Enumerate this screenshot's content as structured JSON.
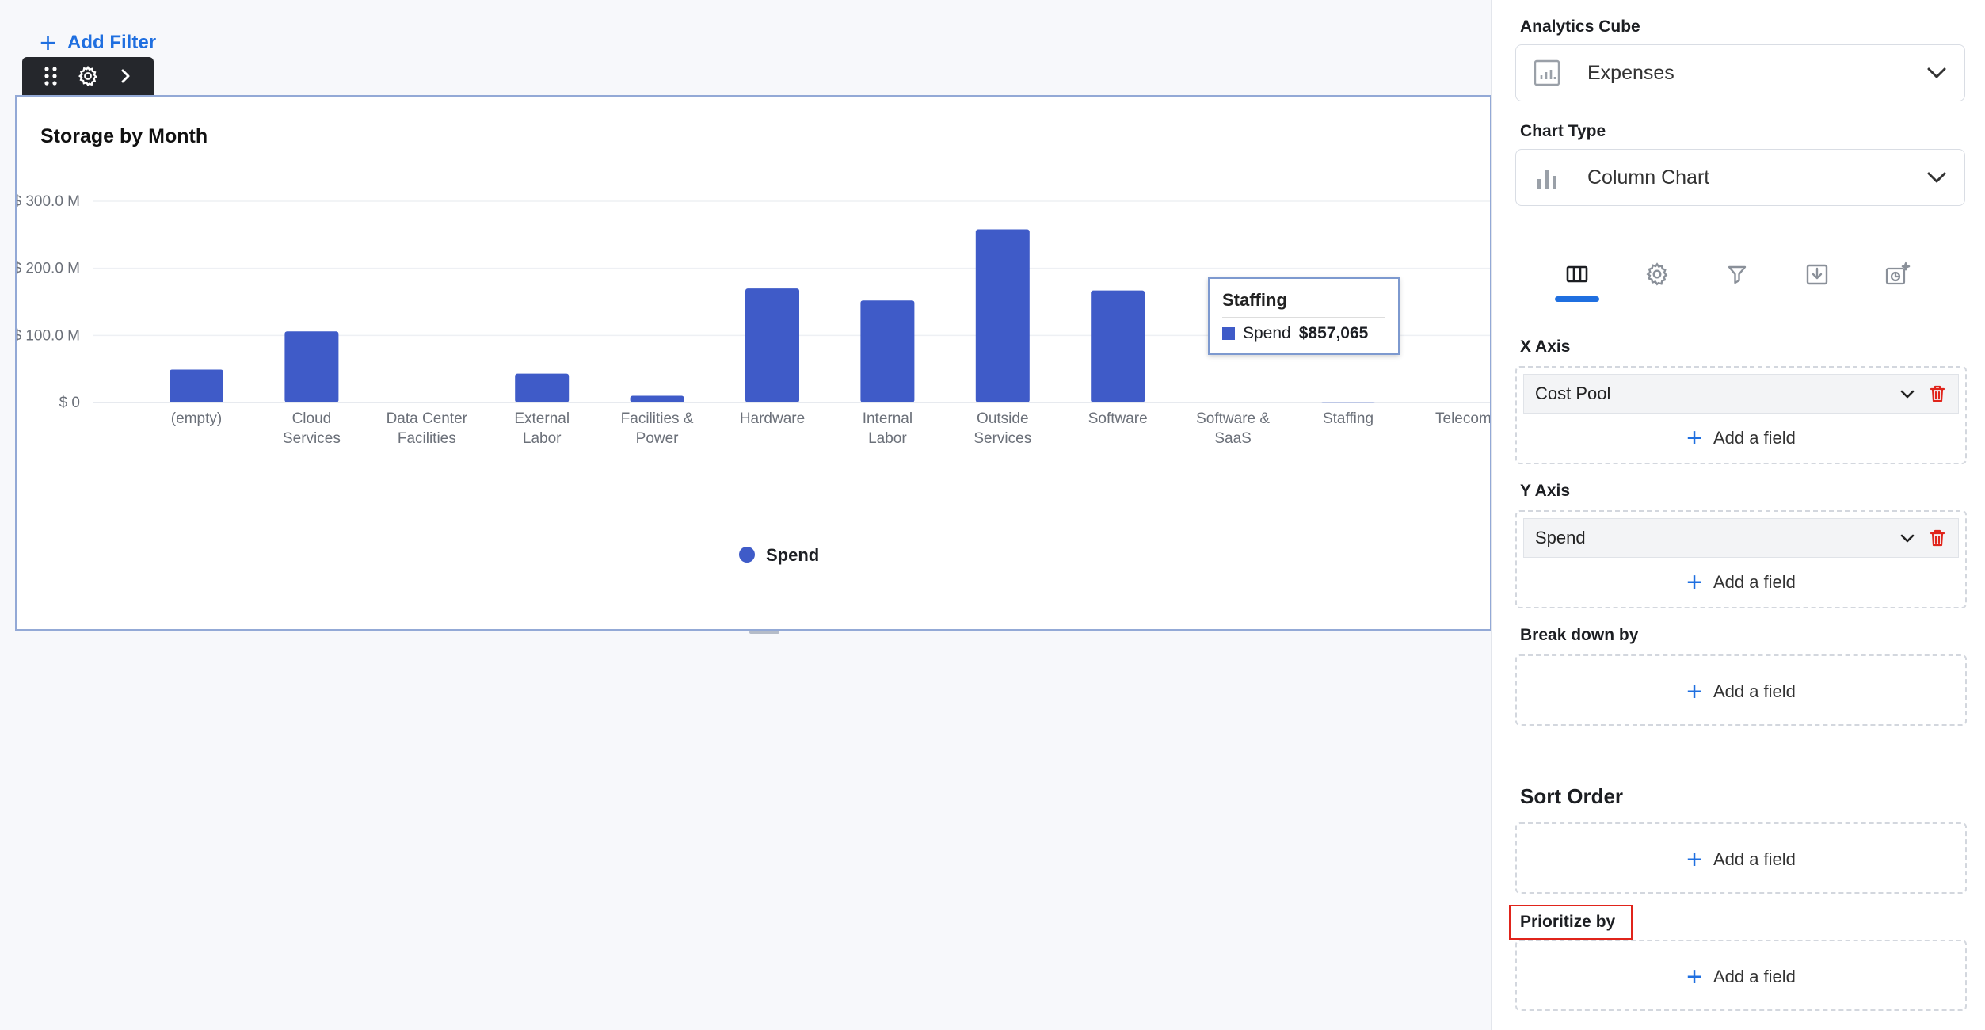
{
  "toolbar": {
    "add_filter_label": "Add Filter"
  },
  "widget": {
    "title": "Storage by Month"
  },
  "tooltip": {
    "title": "Staffing",
    "series": "Spend",
    "value": "$857,065"
  },
  "colors": {
    "bar": "#3f5bc8",
    "accent": "#1f6fe0",
    "danger": "#e0241b"
  },
  "chart_data": {
    "type": "bar",
    "title": "Storage by Month",
    "categories": [
      "(empty)",
      "Cloud Services",
      "Data Center Facilities",
      "External Labor",
      "Facilities & Power",
      "Hardware",
      "Internal Labor",
      "Outside Services",
      "Software",
      "Software & SaaS",
      "Staffing",
      "Telecom"
    ],
    "category_lines": [
      [
        "(empty)"
      ],
      [
        "Cloud",
        "Services"
      ],
      [
        "Data Center",
        "Facilities"
      ],
      [
        "External",
        "Labor"
      ],
      [
        "Facilities &",
        "Power"
      ],
      [
        "Hardware"
      ],
      [
        "Internal",
        "Labor"
      ],
      [
        "Outside",
        "Services"
      ],
      [
        "Software"
      ],
      [
        "Software &",
        "SaaS"
      ],
      [
        "Staffing"
      ],
      [
        "Telecom"
      ]
    ],
    "series": [
      {
        "name": "Spend",
        "values": [
          49,
          106,
          0,
          43,
          10,
          170,
          152,
          258,
          167,
          0,
          0.857065,
          0
        ]
      }
    ],
    "yticks": [
      "$ 300.0 M",
      "$ 200.0 M",
      "$ 100.0 M",
      "$ 0"
    ],
    "ylim": [
      0,
      300
    ],
    "grid": true,
    "legend": "bottom-center"
  },
  "panel": {
    "cube_label": "Analytics Cube",
    "cube_value": "Expenses",
    "chart_type_label": "Chart Type",
    "chart_type_value": "Column Chart",
    "tabs": [
      "columns-icon",
      "gear-icon",
      "filter-icon",
      "download-icon",
      "ai-chart-icon"
    ],
    "x_axis_label": "X Axis",
    "x_axis_field": "Cost Pool",
    "y_axis_label": "Y Axis",
    "y_axis_field": "Spend",
    "breakdown_label": "Break down by",
    "sort_label": "Sort Order",
    "prioritize_label": "Prioritize by",
    "add_field_label": "Add a field"
  }
}
